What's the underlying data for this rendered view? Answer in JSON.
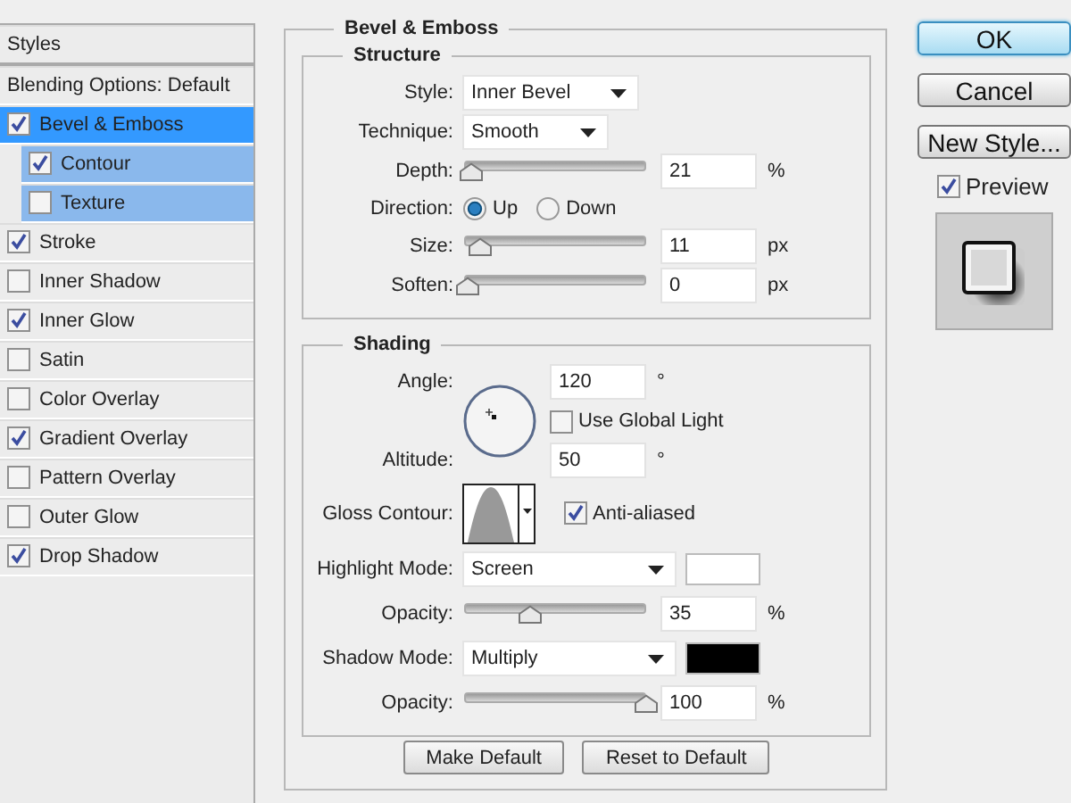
{
  "styles_panel": {
    "header": "Styles",
    "blending_options": "Blending Options: Default",
    "items": [
      {
        "label": "Bevel & Emboss",
        "checked": true,
        "selected": true,
        "children": [
          {
            "label": "Contour",
            "checked": true,
            "selected": false
          },
          {
            "label": "Texture",
            "checked": false,
            "selected": false
          }
        ]
      },
      {
        "label": "Stroke",
        "checked": true,
        "selected": false
      },
      {
        "label": "Inner Shadow",
        "checked": false,
        "selected": false
      },
      {
        "label": "Inner Glow",
        "checked": true,
        "selected": false
      },
      {
        "label": "Satin",
        "checked": false,
        "selected": false
      },
      {
        "label": "Color Overlay",
        "checked": false,
        "selected": false
      },
      {
        "label": "Gradient Overlay",
        "checked": true,
        "selected": false
      },
      {
        "label": "Pattern Overlay",
        "checked": false,
        "selected": false
      },
      {
        "label": "Outer Glow",
        "checked": false,
        "selected": false
      },
      {
        "label": "Drop Shadow",
        "checked": true,
        "selected": false
      }
    ]
  },
  "bevel_emboss": {
    "title": "Bevel & Emboss",
    "structure": {
      "title": "Structure",
      "style": {
        "label": "Style:",
        "value": "Inner Bevel"
      },
      "technique": {
        "label": "Technique:",
        "value": "Smooth"
      },
      "depth": {
        "label": "Depth:",
        "level": 0.02,
        "value": "21",
        "unit": "%"
      },
      "direction": {
        "label": "Direction:",
        "options": [
          {
            "label": "Up",
            "selected": true
          },
          {
            "label": "Down",
            "selected": false
          }
        ]
      },
      "size": {
        "label": "Size:",
        "level": 0.07,
        "value": "11",
        "unit": "px"
      },
      "soften": {
        "label": "Soften:",
        "level": 0,
        "value": "0",
        "unit": "px"
      }
    },
    "shading": {
      "title": "Shading",
      "angle": {
        "label": "Angle:",
        "value": "120",
        "unit": "°"
      },
      "use_global_light": {
        "label": "Use Global Light",
        "checked": false
      },
      "altitude": {
        "label": "Altitude:",
        "value": "50",
        "unit": "°"
      },
      "gloss_contour": {
        "label": "Gloss Contour:"
      },
      "anti_aliased": {
        "label": "Anti-aliased",
        "checked": true
      },
      "highlight_mode": {
        "label": "Highlight Mode:",
        "value": "Screen",
        "color": "#ffffff"
      },
      "highlight_opacity": {
        "label": "Opacity:",
        "level": 0.35,
        "value": "35",
        "unit": "%"
      },
      "shadow_mode": {
        "label": "Shadow Mode:",
        "value": "Multiply",
        "color": "#000000"
      },
      "shadow_opacity": {
        "label": "Opacity:",
        "level": 1,
        "value": "100",
        "unit": "%"
      }
    },
    "buttons": [
      {
        "label": "Make Default"
      },
      {
        "label": "Reset to Default"
      }
    ]
  },
  "side": {
    "buttons": [
      {
        "label": "OK",
        "default": true
      },
      {
        "label": "Cancel",
        "default": false
      },
      {
        "label": "New Style...",
        "default": false
      }
    ],
    "preview": {
      "label": "Preview",
      "checked": true
    }
  }
}
